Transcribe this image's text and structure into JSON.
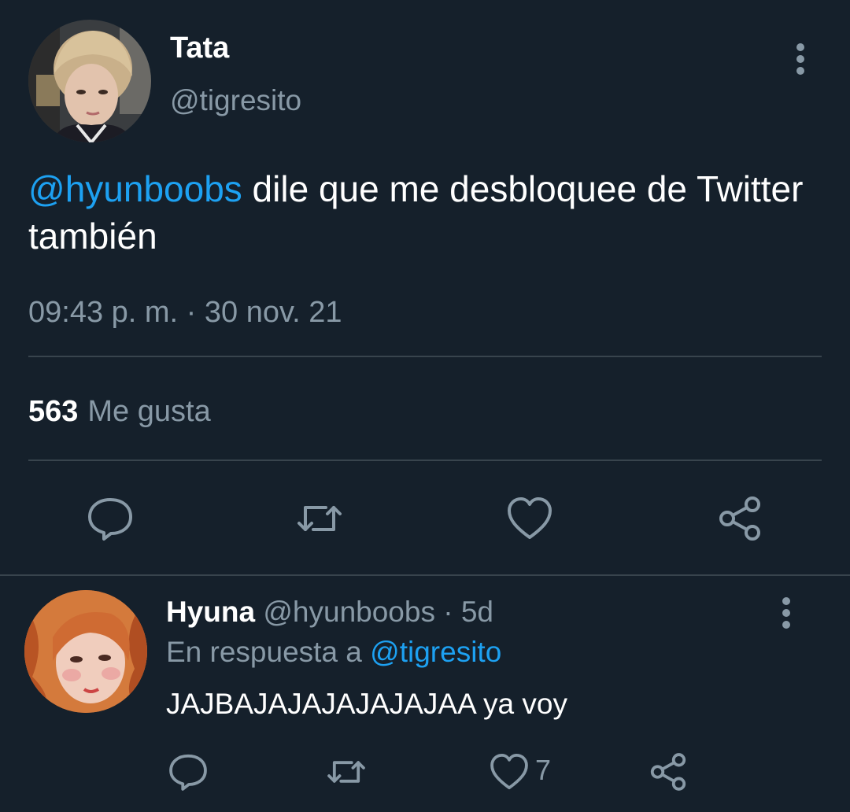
{
  "theme": {
    "background": "#15202b",
    "text_primary": "#ffffff",
    "text_secondary": "#8899a6",
    "accent": "#1da1f2",
    "divider": "#38444d"
  },
  "main_tweet": {
    "author_name": "Tata",
    "author_handle": "@tigresito",
    "avatar": "avatar-photo-tata",
    "more_icon": "more-vertical-icon",
    "mention": "@hyunboobs",
    "text": " dile que me desbloquee de Twitter también",
    "timestamp": "09:43 p. m. · 30 nov. 21",
    "likes_count": "563",
    "likes_label": "Me gusta",
    "actions": [
      "reply-icon",
      "retweet-icon",
      "like-icon",
      "share-icon"
    ]
  },
  "reply_tweet": {
    "author_name": "Hyuna",
    "author_handle": "@hyunboobs",
    "separator": " · ",
    "age": "5d",
    "avatar": "avatar-photo-hyuna",
    "more_icon": "more-vertical-icon",
    "context_prefix": "En respuesta a ",
    "context_mention": "@tigresito",
    "text": "JAJBAJAJAJAJAJAJAA ya voy",
    "like_count": "7",
    "actions": [
      "reply-icon",
      "retweet-icon",
      "like-icon",
      "share-icon"
    ]
  }
}
